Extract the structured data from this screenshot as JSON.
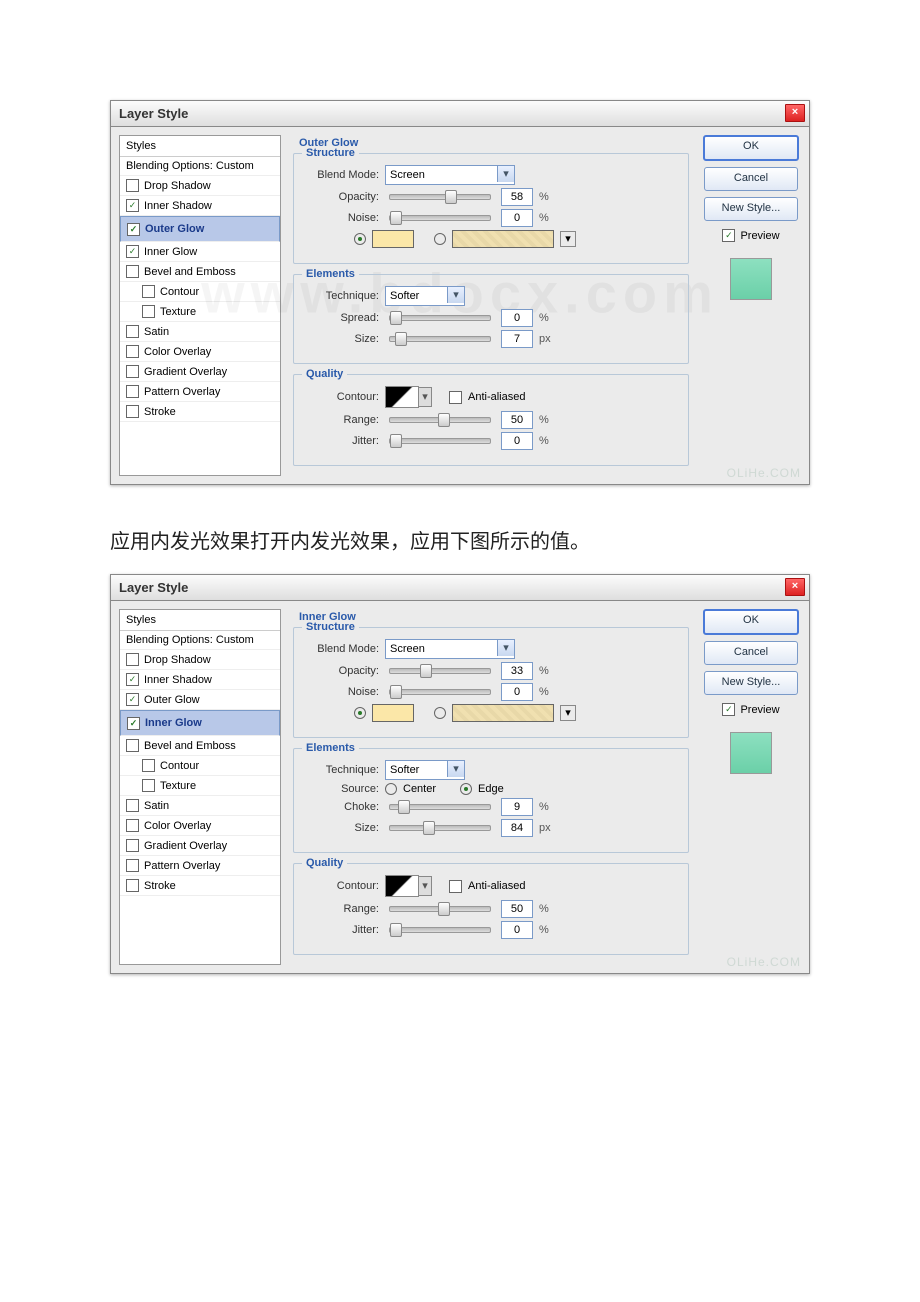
{
  "dialogTitle": "Layer Style",
  "watermark_bg": "www.bdocx.com",
  "watermark_corner": "OLiHe.COM",
  "caption": "应用内发光效果打开内发光效果，应用下图所示的值。",
  "styles": {
    "header": "Styles",
    "blendingOptions": "Blending Options: Custom",
    "items": [
      {
        "label": "Drop Shadow",
        "checked": false,
        "indent": false
      },
      {
        "label": "Inner Shadow",
        "checked": true,
        "indent": false
      },
      {
        "label": "Outer Glow",
        "checked": true,
        "indent": false
      },
      {
        "label": "Inner Glow",
        "checked": true,
        "indent": false
      },
      {
        "label": "Bevel and Emboss",
        "checked": false,
        "indent": false
      },
      {
        "label": "Contour",
        "checked": false,
        "indent": true
      },
      {
        "label": "Texture",
        "checked": false,
        "indent": true
      },
      {
        "label": "Satin",
        "checked": false,
        "indent": false
      },
      {
        "label": "Color Overlay",
        "checked": false,
        "indent": false
      },
      {
        "label": "Gradient Overlay",
        "checked": false,
        "indent": false
      },
      {
        "label": "Pattern Overlay",
        "checked": false,
        "indent": false
      },
      {
        "label": "Stroke",
        "checked": false,
        "indent": false
      }
    ]
  },
  "buttons": {
    "ok": "OK",
    "cancel": "Cancel",
    "newStyle": "New Style...",
    "preview": "Preview"
  },
  "labels": {
    "structure": "Structure",
    "elements": "Elements",
    "quality": "Quality",
    "blendMode": "Blend Mode:",
    "opacity": "Opacity:",
    "noise": "Noise:",
    "technique": "Technique:",
    "spread": "Spread:",
    "size": "Size:",
    "contour": "Contour:",
    "antiAliased": "Anti-aliased",
    "range": "Range:",
    "jitter": "Jitter:",
    "source": "Source:",
    "center": "Center",
    "edge": "Edge",
    "choke": "Choke:",
    "pct": "%",
    "px": "px"
  },
  "dialog1": {
    "title": "Outer Glow",
    "blendMode": "Screen",
    "opacity": "58",
    "noise": "0",
    "technique": "Softer",
    "spread": "0",
    "size": "7",
    "range": "50",
    "jitter": "0"
  },
  "dialog2": {
    "title": "Inner Glow",
    "blendMode": "Screen",
    "opacity": "33",
    "noise": "0",
    "technique": "Softer",
    "source": "Edge",
    "choke": "9",
    "size": "84",
    "range": "50",
    "jitter": "0"
  }
}
